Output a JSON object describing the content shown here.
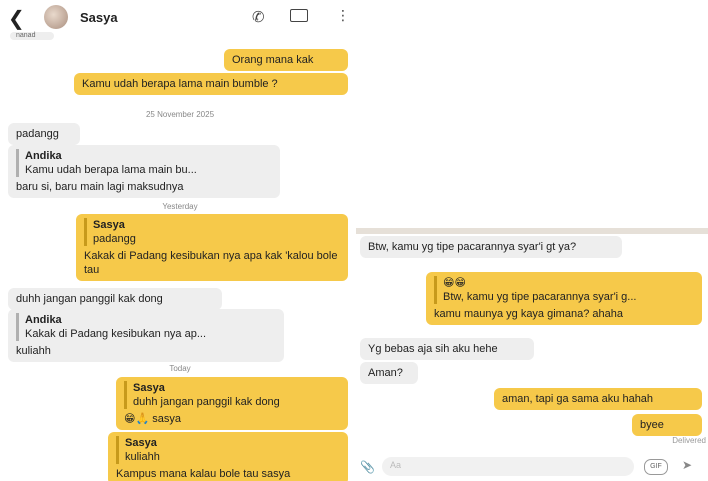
{
  "left": {
    "contact_name": "Sasya",
    "partial_top": "nanad",
    "messages": {
      "m1": "Orang mana kak",
      "m2": "Kamu udah berapa lama main bumble ?",
      "date1": "25 November 2025",
      "m3": "padangg",
      "m4_quote_name": "Andika",
      "m4_quote_text": "Kamu udah berapa lama main bu...",
      "m4_text": "baru si, baru main lagi maksudnya",
      "date2": "Yesterday",
      "m5_quote_name": "Sasya",
      "m5_quote_text": "padangg",
      "m5_text": "Kakak di Padang kesibukan nya apa kak 'kalou bole tau",
      "m6": "duhh jangan panggil kak dong",
      "m7_quote_name": "Andika",
      "m7_quote_text": "Kakak di Padang kesibukan nya ap...",
      "m7_text": "kuliahh",
      "date3": "Today",
      "m8_quote_name": "Sasya",
      "m8_quote_text": "duhh jangan panggil kak dong",
      "m8_text": "😁🙏 sasya",
      "m9_quote_name": "Sasya",
      "m9_quote_text": "kuliahh",
      "m9_text": "Kampus mana kalau bole tau sasya"
    }
  },
  "right": {
    "messages": {
      "r1": "Btw, kamu yg tipe pacarannya syar'i gt ya?",
      "r2_quote_emoji": "😁😁",
      "r2_quote_text": "Btw, kamu yg tipe pacarannya syar'i g...",
      "r2_text": "kamu maunya yg kaya gimana? ahaha",
      "r3": "Yg bebas aja sih aku hehe",
      "r4": "Aman?",
      "r5": "aman, tapi ga sama aku hahah",
      "r6": "byee",
      "status": "Delivered"
    },
    "input_placeholder": "Aa",
    "gif_label": "GIF"
  },
  "icons": {
    "back": "chevron-left-icon",
    "call": "phone-icon",
    "video": "video-icon",
    "more": "more-vertical-icon",
    "attach": "attach-icon",
    "send": "send-icon"
  },
  "colors": {
    "outgoing": "#f6c94a",
    "incoming": "#eeeeee"
  }
}
